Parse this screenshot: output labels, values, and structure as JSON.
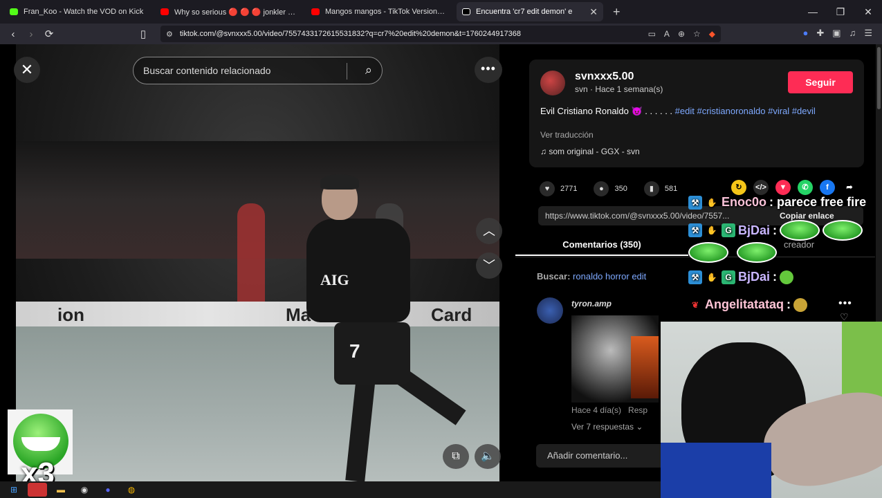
{
  "browser": {
    "tabs": [
      {
        "title": "Fran_Koo - Watch the VOD on Kick",
        "color": "#53fc18"
      },
      {
        "title": "Why so serious 🔴 🔴 🔴 jonkler @s",
        "color": "#ff0000"
      },
      {
        "title": "Mangos mangos - TikTok Version (In",
        "color": "#ff0000"
      },
      {
        "title": "Encuentra 'cr7 edit demon' e",
        "color": "#000000"
      }
    ],
    "url": "tiktok.com/@svnxxx5.00/video/7557433172615531832?q=cr7%20edit%20demon&t=1760244917368",
    "new_tab": "+"
  },
  "video": {
    "search_placeholder": "Buscar contenido relacionado",
    "board_text_left": "ion",
    "board_text_mid": "Ma",
    "board_text_right": "Card",
    "jersey_sponsor": "AIG",
    "jersey_number": "7"
  },
  "post": {
    "username": "svnxxx5.00",
    "subtitle": "svn · Hace 1 semana(s)",
    "follow_label": "Seguir",
    "caption_text": "Evil Cristiano Ronaldo 😈 . . . . . .",
    "caption_tags": "#edit #cristianoronaldo #viral #devil",
    "translate": "Ver traducción",
    "music": "som original - GGX - svn"
  },
  "stats": {
    "likes": "2771",
    "comments": "350",
    "saves": "581"
  },
  "share_link": "https://www.tiktok.com/@svnxxx5.00/video/7557...",
  "copy_link": "Copiar enlace",
  "comments_tabs": {
    "comments": "Comentarios (350)",
    "creator": "creador"
  },
  "related": {
    "prefix": "Buscar:",
    "query": "ronaldo horror edit"
  },
  "comment": {
    "user": "tyron.amp",
    "time": "Hace 4 día(s)",
    "reply": "Resp",
    "replies": "Ver 7 respuestas ⌄"
  },
  "add_comment": "Añadir comentario...",
  "chat": [
    {
      "user": "Enoc0o",
      "message": ": parece free fire"
    },
    {
      "user": "BjDai",
      "message": ":"
    },
    {
      "user": "BjDai",
      "message": ":"
    },
    {
      "user": "Angelitatataq",
      "message": ":"
    }
  ],
  "overlay_counter": "x3"
}
